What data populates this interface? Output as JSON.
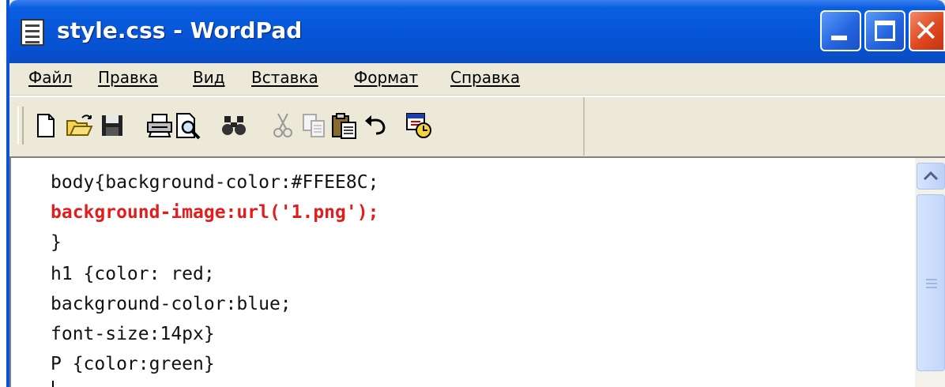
{
  "window": {
    "title": "style.css - WordPad",
    "icon": "wordpad-document-icon",
    "controls": [
      "minimize-icon",
      "maximize-icon",
      "close-icon"
    ]
  },
  "menu": {
    "items": [
      "Файл",
      "Правка",
      "Вид",
      "Вставка",
      "Формат",
      "Справка"
    ]
  },
  "toolbar": {
    "buttons": [
      "new-document-icon",
      "open-folder-icon",
      "save-icon",
      "print-icon",
      "print-preview-icon",
      "find-icon",
      "cut-icon",
      "copy-icon",
      "paste-icon",
      "undo-icon",
      "insert-date-time-icon"
    ]
  },
  "editor": {
    "lines": [
      "body{background-color:#FFEE8C;",
      "background-image:url('1.png');",
      "}",
      "h1 {color: red;",
      "background-color:blue;",
      "font-size:14px}",
      "P {color:green}"
    ],
    "highlight_color": "#e11d1d"
  },
  "colors": {
    "titlebar": "#0756d8",
    "chrome": "#ece9d8",
    "close_button": "#e0481e"
  }
}
